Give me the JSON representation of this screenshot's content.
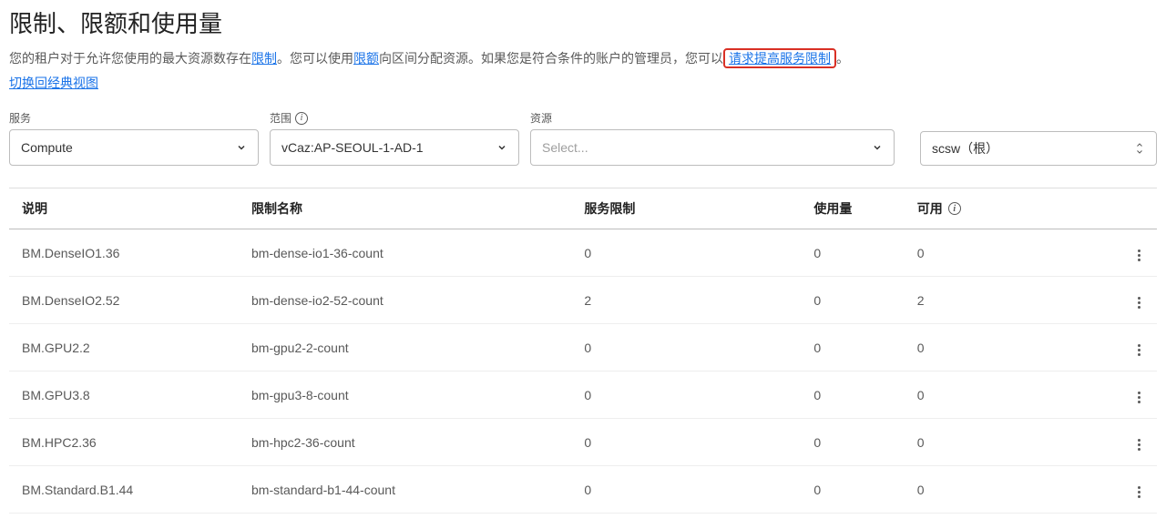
{
  "page": {
    "title": "限制、限额和使用量",
    "desc_parts": {
      "p1": "您的租户对于允许您使用的最大资源数存在",
      "link1": "限制",
      "p2": "。您可以使用",
      "link2": "限额",
      "p3": "向区间分配资源。如果您是符合条件的账户的管理员，您可以",
      "link3": "请求提高服务限制",
      "p4": "。"
    },
    "classic_link": "切换回经典视图"
  },
  "filters": {
    "service": {
      "label": "服务",
      "value": "Compute"
    },
    "scope": {
      "label": "范围",
      "value": "vCaz:AP-SEOUL-1-AD-1"
    },
    "resource": {
      "label": "资源",
      "placeholder": "Select..."
    },
    "compartment": {
      "value": "scsw（根）"
    }
  },
  "table": {
    "headers": {
      "description": "说明",
      "limit_name": "限制名称",
      "service_limit": "服务限制",
      "usage": "使用量",
      "available": "可用"
    },
    "rows": [
      {
        "description": "BM.DenseIO1.36",
        "limit_name": "bm-dense-io1-36-count",
        "service_limit": "0",
        "usage": "0",
        "available": "0"
      },
      {
        "description": "BM.DenseIO2.52",
        "limit_name": "bm-dense-io2-52-count",
        "service_limit": "2",
        "usage": "0",
        "available": "2"
      },
      {
        "description": "BM.GPU2.2",
        "limit_name": "bm-gpu2-2-count",
        "service_limit": "0",
        "usage": "0",
        "available": "0"
      },
      {
        "description": "BM.GPU3.8",
        "limit_name": "bm-gpu3-8-count",
        "service_limit": "0",
        "usage": "0",
        "available": "0"
      },
      {
        "description": "BM.HPC2.36",
        "limit_name": "bm-hpc2-36-count",
        "service_limit": "0",
        "usage": "0",
        "available": "0"
      },
      {
        "description": "BM.Standard.B1.44",
        "limit_name": "bm-standard-b1-44-count",
        "service_limit": "0",
        "usage": "0",
        "available": "0"
      }
    ]
  }
}
